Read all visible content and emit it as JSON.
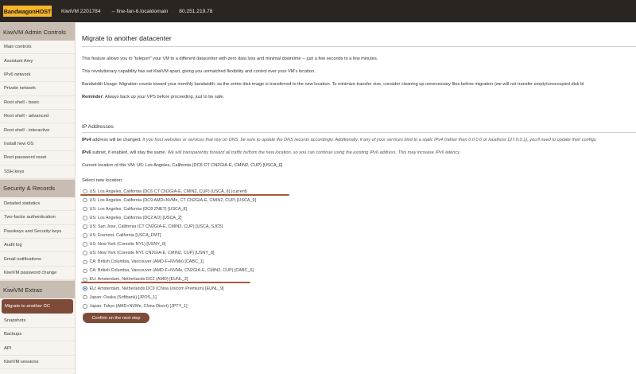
{
  "topbar": {
    "logo_text": "BandwagonHOST",
    "vm_name": "KiwiVM 2201784",
    "hostname": "-- fine-fan-6.localdomain",
    "ip": "80.251.219.78"
  },
  "sidebar": {
    "sections": [
      {
        "title": "KiwiVM Admin Controls",
        "items": [
          {
            "label": "Main controls"
          },
          {
            "label": "Assistant Amy"
          },
          {
            "label": "IPv6 network"
          },
          {
            "label": "Private network"
          },
          {
            "label": "Root shell - basic"
          },
          {
            "label": "Root shell - advanced"
          },
          {
            "label": "Root shell - interactive"
          },
          {
            "label": "Install new OS"
          },
          {
            "label": "Root password reset"
          },
          {
            "label": "SSH keys"
          }
        ]
      },
      {
        "title": "Security & Records",
        "items": [
          {
            "label": "Detailed statistics"
          },
          {
            "label": "Two-factor authentication"
          },
          {
            "label": "Passkeys and Security keys"
          },
          {
            "label": "Audit log"
          },
          {
            "label": "Email notifications"
          },
          {
            "label": "KiwiVM password change"
          }
        ]
      },
      {
        "title": "KiwiVM Extras",
        "items": [
          {
            "label": "Migrate to another DC",
            "active": true
          },
          {
            "label": "Snapshots"
          },
          {
            "label": "Backups"
          },
          {
            "label": "API"
          },
          {
            "label": "KiwiVM sessions"
          }
        ]
      }
    ]
  },
  "main": {
    "title": "Migrate to another datacenter",
    "intro1": "This feature allows you to \"teleport\" your VM to a different datacenter with zero data loss and minimal downtime -- just a few seconds to a few minutes.",
    "intro2": "This revolutionary capability has set KiwiVM apart, giving you unmatched flexibility and control over your VM's location.",
    "bandwidth_label": "Bandwidth Usage:",
    "bandwidth_text": " Migration counts toward your monthly bandwidth, as the entire disk image is transferred to the new location. To minimize transfer size, consider cleaning up unnecessary files before migration (we will not transfer empty/unoccupied disk bl",
    "reminder_label": "Reminder:",
    "reminder_text": " Always back up your VPS before proceeding, just to be safe.",
    "ip_section_title": "IP Addresses",
    "ipv4_label": "IPv4",
    "ipv4_text": " address will be changed. ",
    "ipv4_note": "If you host websites or services that rely on DNS, be sure to update the DNS records accordingly. Additionally, if any of your services bind to a static IPv4 (rather than 0.0.0.0 or localhost 127.0.0.1), you'll need to update their configu",
    "ipv6_label": "IPv6",
    "ipv6_text": " subnet, if enabled, will stay the same. ",
    "ipv6_note": "We will transparently forward all traffic to/from the new location, so you can continue using the existing IPv6 address. This may increase IPv6 latency.",
    "current_location": "Current location of this VM: US: Los Angeles, California (DC6 CT CN2GIA-E, CMIN2, CUP) [USCA_6]",
    "select_label": "Select new location:",
    "locations": [
      {
        "label": "US: Los Angeles, California (DC6 CT CN2GIA-E, CMIN2, CUP) [USCA_6] (current)",
        "checked": false
      },
      {
        "label": "US: Los Angeles, California (DC9 AMD+NVMe, CT CN2GIA-E, CMIN2, CUP) [USCA_9]",
        "checked": false
      },
      {
        "label": "US: Los Angeles, California (DC8 ZNET) [USCA_8]",
        "checked": false
      },
      {
        "label": "US: Los Angeles, California (DC2 AO) [USCA_2]",
        "checked": false
      },
      {
        "label": "US: San Jose, California (CT CN2GIA-E, CMIN2, CUP) [USCA_SJC5]",
        "checked": false
      },
      {
        "label": "US: Fremont, California [USCA_FMT]",
        "checked": false
      },
      {
        "label": "US: New York (Coresite NY1) [USNY_6]",
        "checked": false
      },
      {
        "label": "US: New York (Coresite NY1 CN2GIA-E, CMIN2, CUP) [USNY_8]",
        "checked": false
      },
      {
        "label": "CA: British Columbia, Vancouver (AMD-F+NVMe) [CABC_1]",
        "checked": false
      },
      {
        "label": "CA: British Columbia, Vancouver (AMD-F+NVMe, CN2GIA-E, CMIN2, CUP) [CABC_6]",
        "checked": false
      },
      {
        "label": "EU: Amsterdam, Netherlands DC2 (AMD) [EUNL_2]",
        "checked": false
      },
      {
        "label": "EU: Amsterdam, Netherlands DC9 (China Unicom Premium) [EUNL_9]",
        "checked": true
      },
      {
        "label": "Japan: Osaka (Softbank) [JPOS_1]",
        "checked": false
      },
      {
        "label": "Japan: Tokyo (AMD+NVMe, China Direct) [JPTY_1]",
        "checked": false
      },
      {
        "label": "UAE: Dubai [AEDXB_1]",
        "checked": false
      }
    ],
    "confirm_label": "Confirm on the next step"
  },
  "colors": {
    "topbar_bg": "#2b2522",
    "logo_bg": "#f6b52a",
    "accent": "#7e4b38",
    "annotation_underline": "#a55a3c"
  }
}
